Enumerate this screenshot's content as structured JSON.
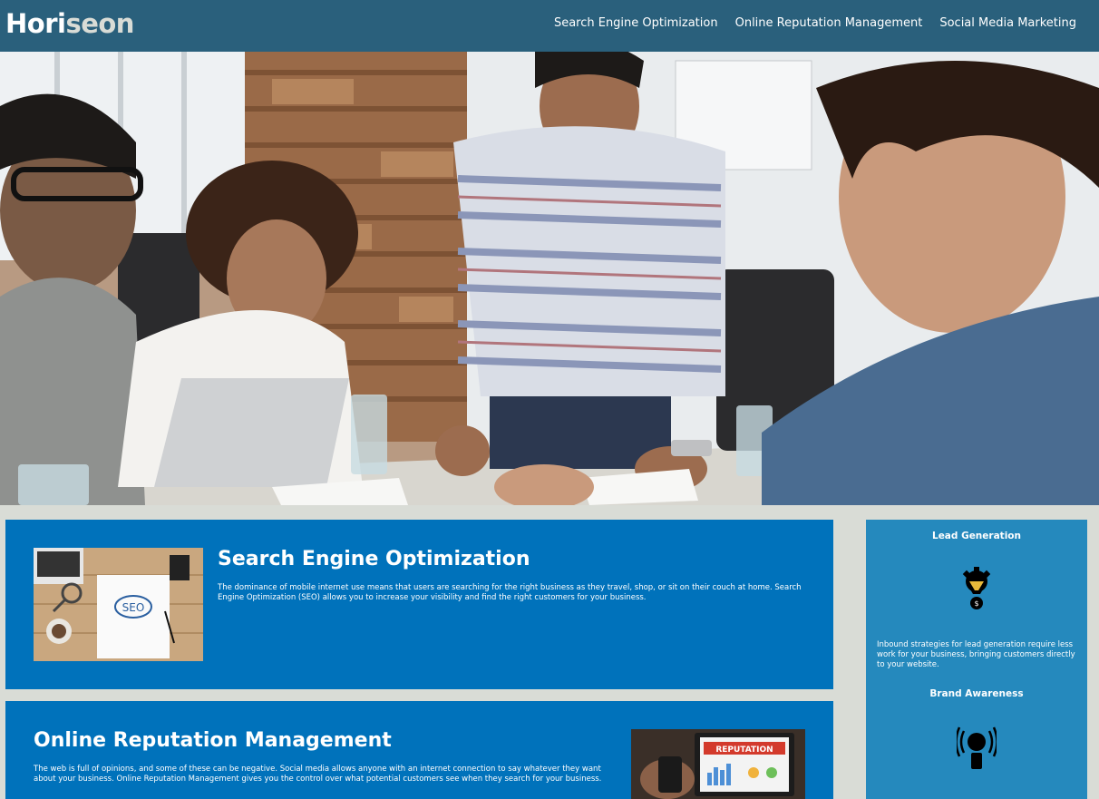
{
  "header": {
    "logo_part1": "Hori",
    "logo_part2": "seon",
    "nav": [
      {
        "label": "Search Engine Optimization"
      },
      {
        "label": "Online Reputation Management"
      },
      {
        "label": "Social Media Marketing"
      }
    ]
  },
  "content": {
    "seo": {
      "title": "Search Engine Optimization",
      "text": "The dominance of mobile internet use means that users are searching for the right business as they travel, shop, or sit on their couch at home. Search Engine Optimization (SEO) allows you to increase your visibility and find the right customers for your business.",
      "image_label": "SEO"
    },
    "orm": {
      "title": "Online Reputation Management",
      "text": "The web is full of opinions, and some of these can be negative. Social media allows anyone with an internet connection to say whatever they want about your business. Online Reputation Management gives you the control over what potential customers see when they search for your business.",
      "image_label": "REPUTATION"
    }
  },
  "sidebar": {
    "lead": {
      "title": "Lead Generation",
      "text": "Inbound strategies for lead generation require less work for your business, bringing customers directly to your website."
    },
    "brand": {
      "title": "Brand Awareness"
    }
  },
  "colors": {
    "header_bg": "#2a607c",
    "card_bg": "#0072bb",
    "sidebar_bg": "#2589bd",
    "page_bg": "#d9dcd6"
  }
}
